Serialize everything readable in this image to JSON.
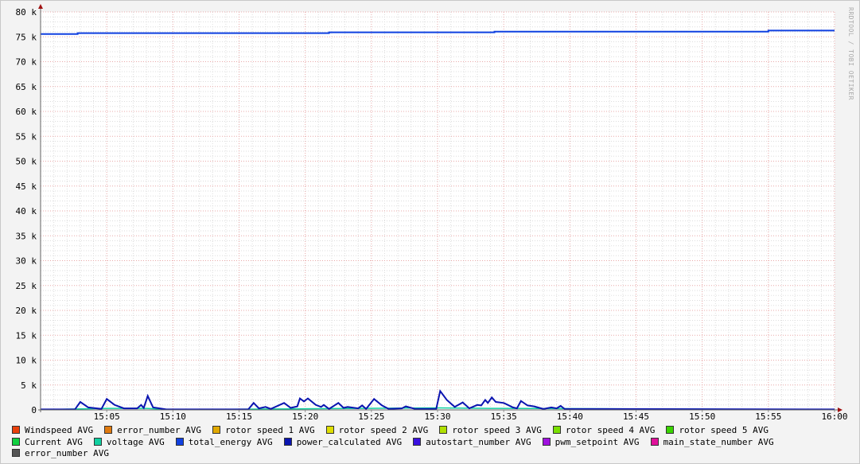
{
  "watermark": "RRDTOOL / TOBI OETIKER",
  "chart_data": {
    "type": "line",
    "title": "",
    "xlabel": "",
    "ylabel": "",
    "xlim_minutes_after_1500": [
      0,
      60
    ],
    "ylim": [
      0,
      80000
    ],
    "grid": true,
    "y_ticks": [
      {
        "v": 0,
        "label": "0"
      },
      {
        "v": 5000,
        "label": "5 k"
      },
      {
        "v": 10000,
        "label": "10 k"
      },
      {
        "v": 15000,
        "label": "15 k"
      },
      {
        "v": 20000,
        "label": "20 k"
      },
      {
        "v": 25000,
        "label": "25 k"
      },
      {
        "v": 30000,
        "label": "30 k"
      },
      {
        "v": 35000,
        "label": "35 k"
      },
      {
        "v": 40000,
        "label": "40 k"
      },
      {
        "v": 45000,
        "label": "45 k"
      },
      {
        "v": 50000,
        "label": "50 k"
      },
      {
        "v": 55000,
        "label": "55 k"
      },
      {
        "v": 60000,
        "label": "60 k"
      },
      {
        "v": 65000,
        "label": "65 k"
      },
      {
        "v": 70000,
        "label": "70 k"
      },
      {
        "v": 75000,
        "label": "75 k"
      },
      {
        "v": 80000,
        "label": "80 k"
      }
    ],
    "x_ticks": [
      {
        "v": 5,
        "label": "15:05"
      },
      {
        "v": 10,
        "label": "15:10"
      },
      {
        "v": 15,
        "label": "15:15"
      },
      {
        "v": 20,
        "label": "15:20"
      },
      {
        "v": 25,
        "label": "15:25"
      },
      {
        "v": 30,
        "label": "15:30"
      },
      {
        "v": 35,
        "label": "15:35"
      },
      {
        "v": 40,
        "label": "15:40"
      },
      {
        "v": 45,
        "label": "15:45"
      },
      {
        "v": 50,
        "label": "15:50"
      },
      {
        "v": 55,
        "label": "15:55"
      },
      {
        "v": 60,
        "label": "16:00"
      }
    ],
    "legend_placement": "bottom",
    "legend": [
      {
        "name": "Windspeed AVG",
        "color": "#e8400c"
      },
      {
        "name": "error_number AVG",
        "color": "#e07b10"
      },
      {
        "name": "rotor speed 1 AVG",
        "color": "#e0a800"
      },
      {
        "name": "rotor speed 2 AVG",
        "color": "#dede00"
      },
      {
        "name": "rotor speed 3 AVG",
        "color": "#b0e000"
      },
      {
        "name": "rotor speed 4 AVG",
        "color": "#7ae000"
      },
      {
        "name": "rotor speed 5 AVG",
        "color": "#3ad400"
      },
      {
        "name": "Current AVG",
        "color": "#10d040"
      },
      {
        "name": "voltage AVG",
        "color": "#10d0a0"
      },
      {
        "name": "total_energy AVG",
        "color": "#1040e0"
      },
      {
        "name": "power_calculated AVG",
        "color": "#0a14b0"
      },
      {
        "name": "autostart_number AVG",
        "color": "#3a10e0"
      },
      {
        "name": "pwm_setpoint AVG",
        "color": "#a010e0"
      },
      {
        "name": "main_state_number AVG",
        "color": "#e0109a"
      },
      {
        "name": "error_number AVG",
        "color": "#555555"
      }
    ],
    "series": [
      {
        "name": "total_energy AVG",
        "color": "#1040e0",
        "points": [
          [
            0,
            75550
          ],
          [
            2.8,
            75550
          ],
          [
            2.8,
            75750
          ],
          [
            21.8,
            75750
          ],
          [
            21.8,
            75900
          ],
          [
            34.3,
            75900
          ],
          [
            34.3,
            76050
          ],
          [
            55,
            76050
          ],
          [
            55,
            76250
          ],
          [
            60,
            76250
          ]
        ]
      },
      {
        "name": "power_calculated AVG",
        "color": "#0a14b0",
        "points": [
          [
            0,
            100
          ],
          [
            2.6,
            100
          ],
          [
            3.0,
            1600
          ],
          [
            3.6,
            500
          ],
          [
            4.6,
            200
          ],
          [
            5.0,
            2200
          ],
          [
            5.6,
            1000
          ],
          [
            6.3,
            300
          ],
          [
            7.3,
            300
          ],
          [
            7.6,
            1000
          ],
          [
            7.8,
            400
          ],
          [
            8.1,
            2800
          ],
          [
            8.5,
            500
          ],
          [
            9.5,
            100
          ],
          [
            15.7,
            100
          ],
          [
            16.1,
            1400
          ],
          [
            16.5,
            300
          ],
          [
            17.0,
            600
          ],
          [
            17.4,
            200
          ],
          [
            18.4,
            1400
          ],
          [
            18.9,
            400
          ],
          [
            19.4,
            700
          ],
          [
            19.6,
            2300
          ],
          [
            19.9,
            1700
          ],
          [
            20.2,
            2300
          ],
          [
            20.8,
            1000
          ],
          [
            21.2,
            600
          ],
          [
            21.4,
            1000
          ],
          [
            21.8,
            200
          ],
          [
            22.5,
            1400
          ],
          [
            22.9,
            400
          ],
          [
            23.2,
            600
          ],
          [
            24.0,
            300
          ],
          [
            24.3,
            900
          ],
          [
            24.6,
            200
          ],
          [
            25.2,
            2200
          ],
          [
            25.8,
            900
          ],
          [
            26.3,
            200
          ],
          [
            27.3,
            300
          ],
          [
            27.6,
            700
          ],
          [
            28.3,
            200
          ],
          [
            29.9,
            200
          ],
          [
            30.2,
            3800
          ],
          [
            30.7,
            2000
          ],
          [
            31.3,
            600
          ],
          [
            31.9,
            1500
          ],
          [
            32.4,
            300
          ],
          [
            33.0,
            1000
          ],
          [
            33.3,
            900
          ],
          [
            33.6,
            2000
          ],
          [
            33.8,
            1400
          ],
          [
            34.1,
            2500
          ],
          [
            34.4,
            1600
          ],
          [
            35.0,
            1400
          ],
          [
            35.7,
            500
          ],
          [
            36.0,
            300
          ],
          [
            36.3,
            1800
          ],
          [
            36.8,
            900
          ],
          [
            37.3,
            700
          ],
          [
            38.0,
            200
          ],
          [
            38.6,
            500
          ],
          [
            39.0,
            300
          ],
          [
            39.3,
            800
          ],
          [
            39.6,
            200
          ],
          [
            60,
            100
          ]
        ]
      },
      {
        "name": "voltage AVG",
        "color": "#10d0a0",
        "points": [
          [
            0,
            50
          ],
          [
            5,
            300
          ],
          [
            8,
            300
          ],
          [
            10,
            50
          ],
          [
            30,
            400
          ],
          [
            34,
            300
          ],
          [
            60,
            50
          ]
        ]
      }
    ]
  }
}
